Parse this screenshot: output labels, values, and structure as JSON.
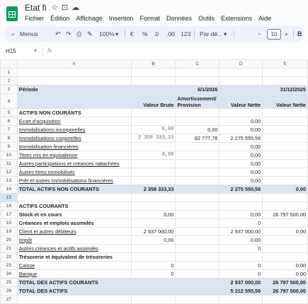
{
  "app": {
    "title": "Etat fi",
    "menu": [
      "Fichier",
      "Édition",
      "Affichage",
      "Insertion",
      "Format",
      "Données",
      "Outils",
      "Extensions",
      "Aide"
    ]
  },
  "toolbar": {
    "menus": "Menus",
    "zoom": "100%",
    "currency": "€",
    "percent": "%",
    "dec_less": ".0",
    "dec_more": ".00",
    "number_format": "123",
    "font": "Par dé...",
    "font_size": "10",
    "minus": "−",
    "plus": "+"
  },
  "formula_bar": {
    "cell_ref": "H15",
    "fx": "fx",
    "value": ""
  },
  "columns": [
    "A",
    "B",
    "C",
    "D",
    "E"
  ],
  "rows": [
    {
      "n": "1",
      "cells": [
        "",
        "",
        "",
        "",
        ""
      ]
    },
    {
      "n": "2",
      "cells": [
        "",
        "",
        "",
        "",
        ""
      ]
    },
    {
      "n": "3",
      "cells": [
        "Période",
        "",
        "6/1/2026",
        "",
        "31/12/2025"
      ],
      "style": "blue"
    },
    {
      "n": "4",
      "cells": [
        "",
        "Valeur Brute",
        "Amortissement/ Provision",
        "Valeur Nette",
        "Valeur Nette"
      ],
      "style": "blue"
    },
    {
      "n": "5",
      "cells": [
        "ACTIFS NON COURANTS",
        "",
        "",
        "",
        ""
      ],
      "bold": true
    },
    {
      "n": "6",
      "cells": [
        "Ecart d'acquisition",
        "",
        "",
        "0,00",
        ""
      ]
    },
    {
      "n": "7",
      "cells": [
        "Immobilisations incorporelles",
        "0,00",
        "0,00",
        "0,00",
        ""
      ]
    },
    {
      "n": "8",
      "cells": [
        "Immobilisations corporelles",
        "2 358 333,33",
        "82 777,78",
        "2 275 555,56",
        ""
      ]
    },
    {
      "n": "9",
      "cells": [
        "Immobilisation financières",
        "",
        "",
        "0,00",
        ""
      ]
    },
    {
      "n": "10",
      "cells": [
        "Titres mis en équivalence",
        "0,00",
        "",
        "0,00",
        ""
      ]
    },
    {
      "n": "11",
      "cells": [
        "Autres participations et créances rattachées",
        "",
        "",
        "0,00",
        ""
      ]
    },
    {
      "n": "12",
      "cells": [
        "Autres titres immobilisés",
        "",
        "",
        "0,00",
        ""
      ]
    },
    {
      "n": "13",
      "cells": [
        "Prêt et autres immobilisations financières",
        "",
        "",
        "0,00",
        ""
      ]
    },
    {
      "n": "14",
      "cells": [
        "TOTAL ACTIFS NON COURANTS",
        "2 358 333,33",
        "",
        "2 275 555,56",
        "0,00"
      ],
      "style": "blue"
    },
    {
      "n": "15",
      "cells": [
        "",
        "",
        "",
        "",
        ""
      ],
      "selected": true
    },
    {
      "n": "16",
      "cells": [
        "ACTIFS COURANTS",
        "",
        "",
        "",
        ""
      ],
      "bold": true
    },
    {
      "n": "17",
      "cells": [
        "Stock et en cours",
        "0,00",
        "",
        "0,00",
        "26 797 500,00"
      ],
      "bold": true
    },
    {
      "n": "18",
      "cells": [
        "Créances et emplois assimilés",
        "",
        "",
        "0",
        ""
      ],
      "bold": true
    },
    {
      "n": "19",
      "cells": [
        "Client et autres débiteurs",
        "2 937 000,00",
        "",
        "2 937 000,00",
        "0,00"
      ]
    },
    {
      "n": "20",
      "cells": [
        "Impôt",
        "0,00",
        "",
        "0,00",
        ""
      ]
    },
    {
      "n": "21",
      "cells": [
        "Autres créances et actifs assimilés",
        "",
        "",
        "0",
        ""
      ]
    },
    {
      "n": "22",
      "cells": [
        "Trésorerie et équivalent de trésoreries",
        "",
        "",
        "",
        ""
      ],
      "bold": true
    },
    {
      "n": "23",
      "cells": [
        "Caisse",
        "0",
        "",
        "0",
        "0,00"
      ]
    },
    {
      "n": "24",
      "cells": [
        "Banque",
        "0",
        "",
        "0",
        "0,00"
      ]
    },
    {
      "n": "25",
      "cells": [
        "TOTAL DES ACTIFS COURANTS",
        "",
        "",
        "2 937 000,00",
        "26 797 500,00"
      ],
      "style": "blue"
    },
    {
      "n": "26",
      "cells": [
        "TOTAL DES ACTIFS",
        "",
        "",
        "5 212 555,56",
        "26 797 500,00"
      ],
      "style": "blue"
    },
    {
      "n": "27",
      "cells": [
        "",
        "",
        "",
        "",
        ""
      ]
    }
  ]
}
